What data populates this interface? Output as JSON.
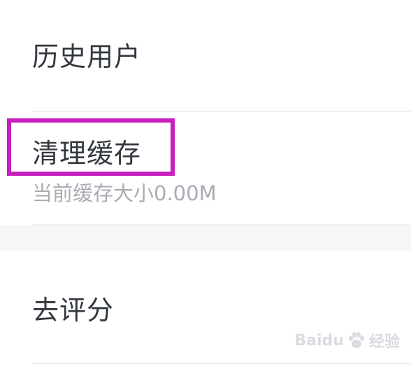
{
  "settings": {
    "history_users": {
      "title": "历史用户"
    },
    "clear_cache": {
      "title": "清理缓存",
      "subtitle": "当前缓存大小0.00M"
    },
    "rate": {
      "title": "去评分"
    }
  },
  "watermark": {
    "brand": "Baidu",
    "suffix": "经验",
    "icon": "paw-icon"
  },
  "colors": {
    "highlight": "#c81fbf",
    "title_text": "#33383f",
    "subtitle_text": "#a9adb3",
    "section_gap": "#f5f6f8"
  }
}
